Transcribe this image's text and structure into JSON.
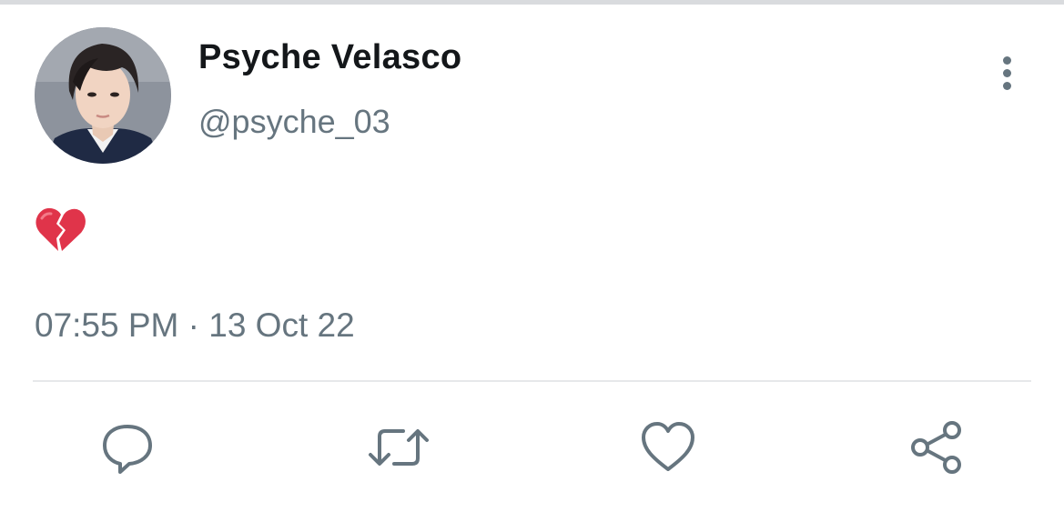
{
  "tweet": {
    "display_name": "Psyche Velasco",
    "handle": "@psyche_03",
    "text": "💔",
    "timestamp": "07:55 PM · 13 Oct 22"
  },
  "icons": {
    "more": "more-vertical-icon",
    "reply": "reply-icon",
    "retweet": "retweet-icon",
    "like": "heart-icon",
    "share": "share-icon"
  },
  "colors": {
    "name": "#14171a",
    "secondary": "#66757f",
    "divider": "#e6e8ea",
    "broken_heart": "#e0344a"
  }
}
